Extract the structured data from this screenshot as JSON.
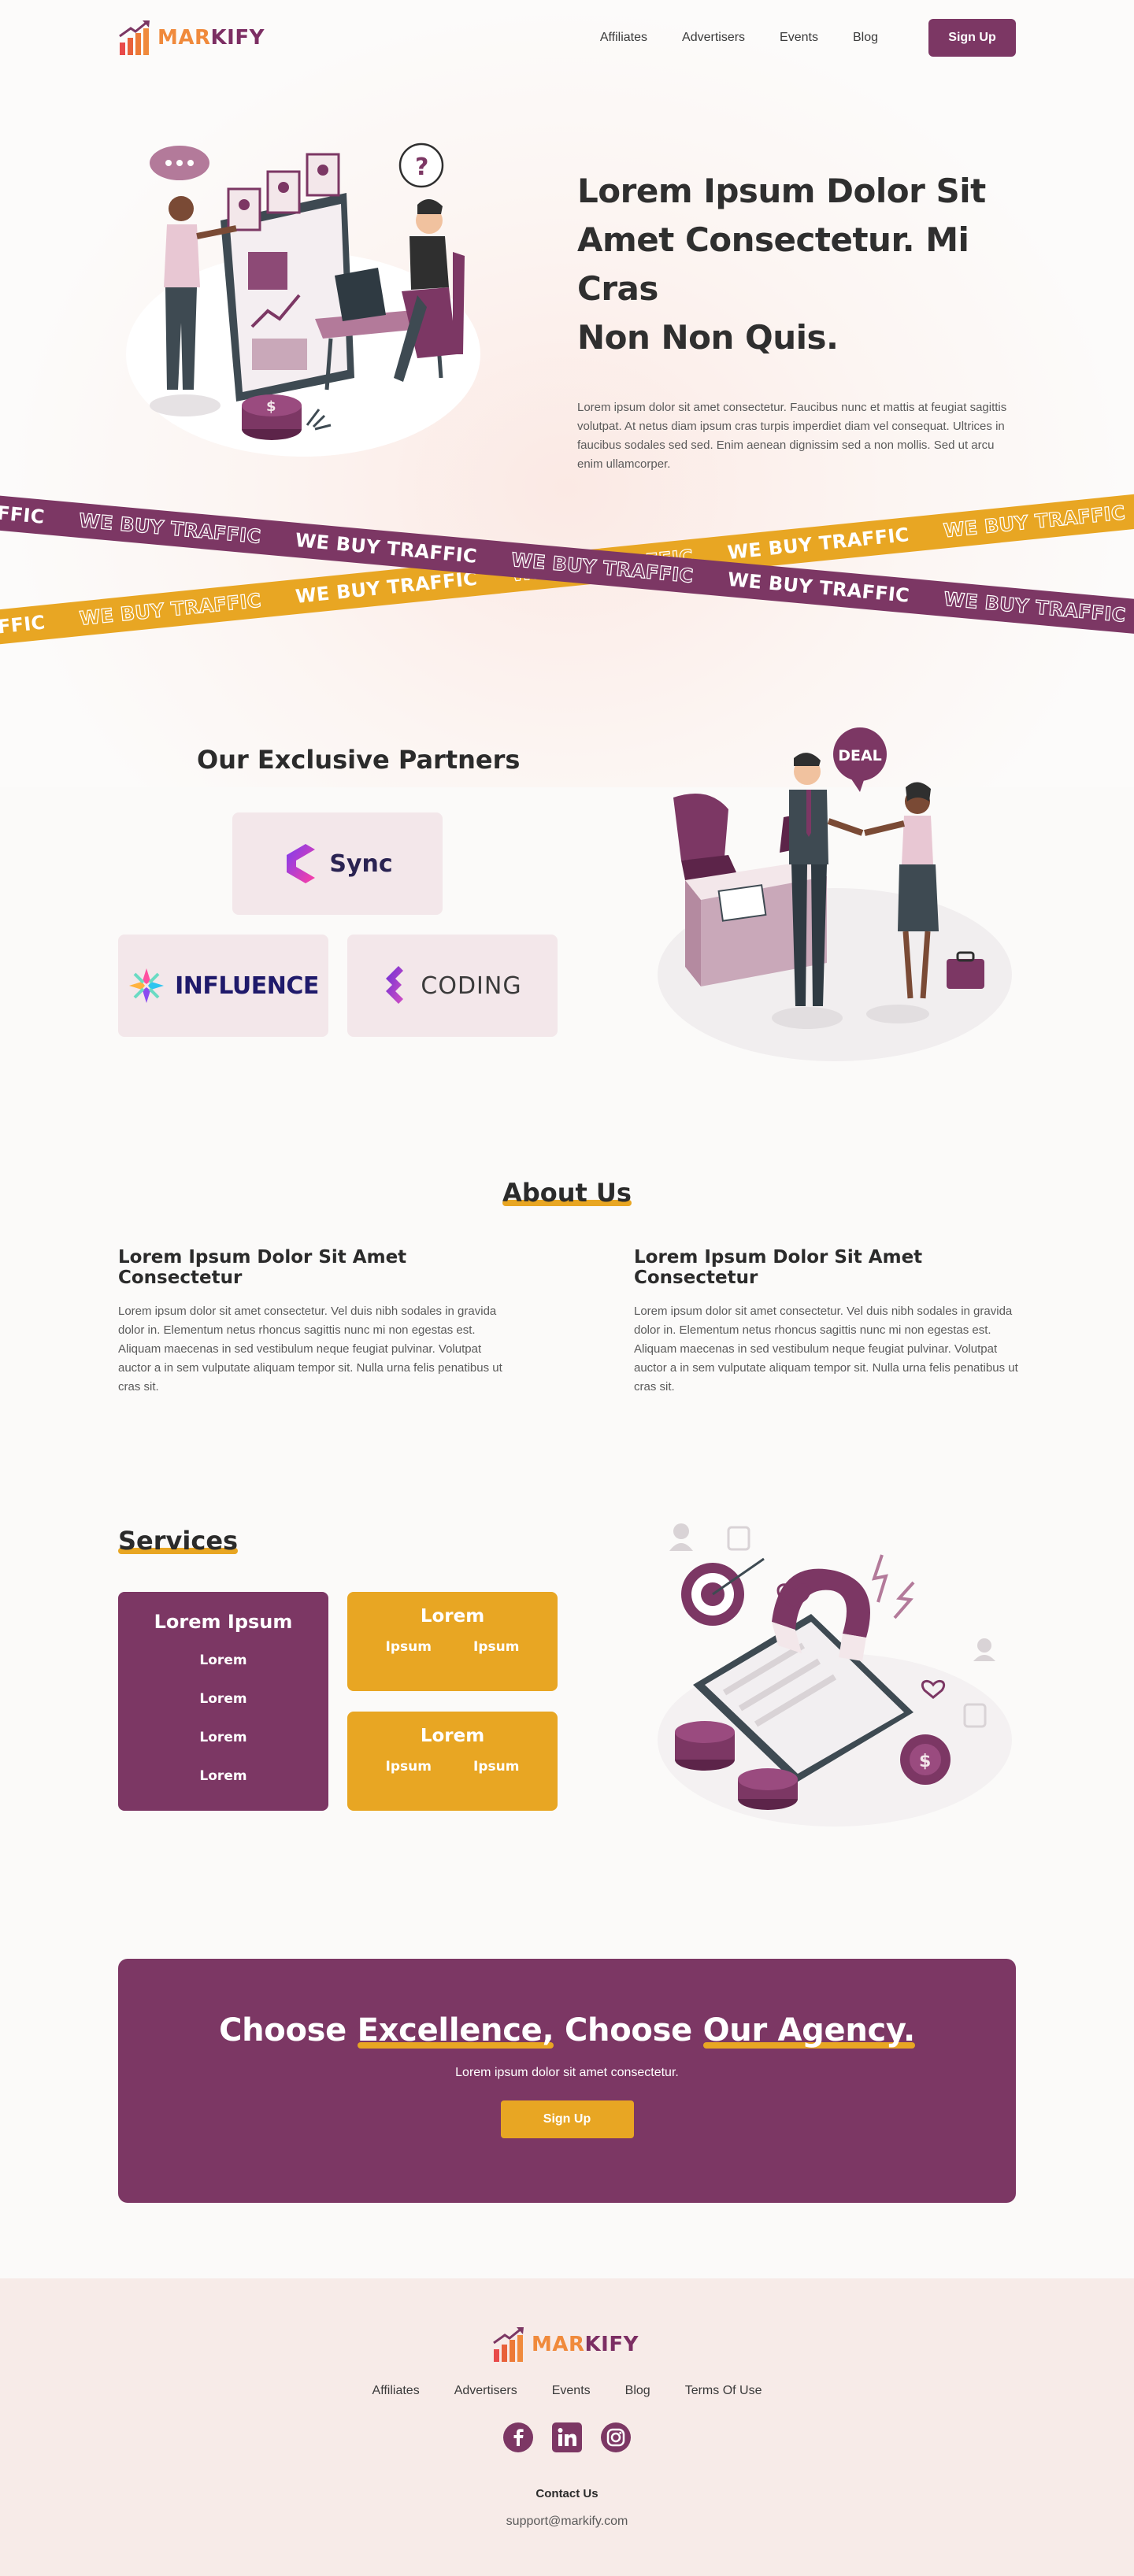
{
  "brand": {
    "name_part1": "MAR",
    "name_part2": "KIFY"
  },
  "nav": {
    "links": [
      "Affiliates",
      "Advertisers",
      "Events",
      "Blog"
    ],
    "signup": "Sign Up"
  },
  "hero": {
    "title_line1": "Lorem Ipsum Dolor Sit",
    "title_line2": "Amet Consectetur. Mi Cras",
    "title_highlight": "Non Non Quis.",
    "description": "Lorem ipsum dolor sit amet consectetur. Faucibus nunc et mattis at feugiat sagittis volutpat. At netus diam ipsum cras turpis imperdiet diam vel consequat. Ultrices in faucibus sodales sed sed. Enim aenean dignissim sed a non mollis. Sed ut arcu enim ullamcorper."
  },
  "ribbon": {
    "text": "WE BUY TRAFFIC"
  },
  "partners": {
    "title": "Our Exclusive Partners",
    "items": [
      "Sync",
      "INFLUENCE",
      "CODING"
    ],
    "deal_bubble": "DEAL"
  },
  "about": {
    "title": "About Us",
    "columns": [
      {
        "heading": "Lorem Ipsum Dolor Sit Amet Consectetur",
        "text": "Lorem ipsum dolor sit amet consectetur. Vel duis nibh sodales in gravida dolor in. Elementum netus rhoncus sagittis nunc mi non egestas est. Aliquam maecenas in sed vestibulum neque feugiat pulvinar. Volutpat auctor a in sem vulputate aliquam tempor sit. Nulla urna felis penatibus ut cras sit."
      },
      {
        "heading": "Lorem Ipsum Dolor Sit Amet Consectetur",
        "text": "Lorem ipsum dolor sit amet consectetur. Vel duis nibh sodales in gravida dolor in. Elementum netus rhoncus sagittis nunc mi non egestas est. Aliquam maecenas in sed vestibulum neque feugiat pulvinar. Volutpat auctor a in sem vulputate aliquam tempor sit. Nulla urna felis penatibus ut cras sit."
      }
    ]
  },
  "services": {
    "title": "Services",
    "main_card": {
      "title": "Lorem Ipsum",
      "items": [
        "Lorem",
        "Lorem",
        "Lorem",
        "Lorem"
      ]
    },
    "small_cards": [
      {
        "title": "Lorem",
        "items": [
          "Ipsum",
          "Ipsum"
        ]
      },
      {
        "title": "Lorem",
        "items": [
          "Ipsum",
          "Ipsum"
        ]
      }
    ]
  },
  "cta": {
    "title_part1": "Choose ",
    "title_hl1": "Excellence,",
    "title_part2": " Choose ",
    "title_hl2": "Our Agency.",
    "description": "Lorem ipsum dolor sit amet consectetur.",
    "button": "Sign Up"
  },
  "footer": {
    "links": [
      "Affiliates",
      "Advertisers",
      "Events",
      "Blog",
      "Terms Of Use"
    ],
    "social_icons": [
      "facebook-icon",
      "linkedin-icon",
      "instagram-icon"
    ],
    "contact_label": "Contact Us",
    "email": "support@markify.com"
  },
  "colors": {
    "plum": "#7c3764",
    "gold": "#e8a623",
    "orange": "#f08a3c",
    "partner_card": "#f3e7ea",
    "footer_bg": "#f7ebe8"
  }
}
